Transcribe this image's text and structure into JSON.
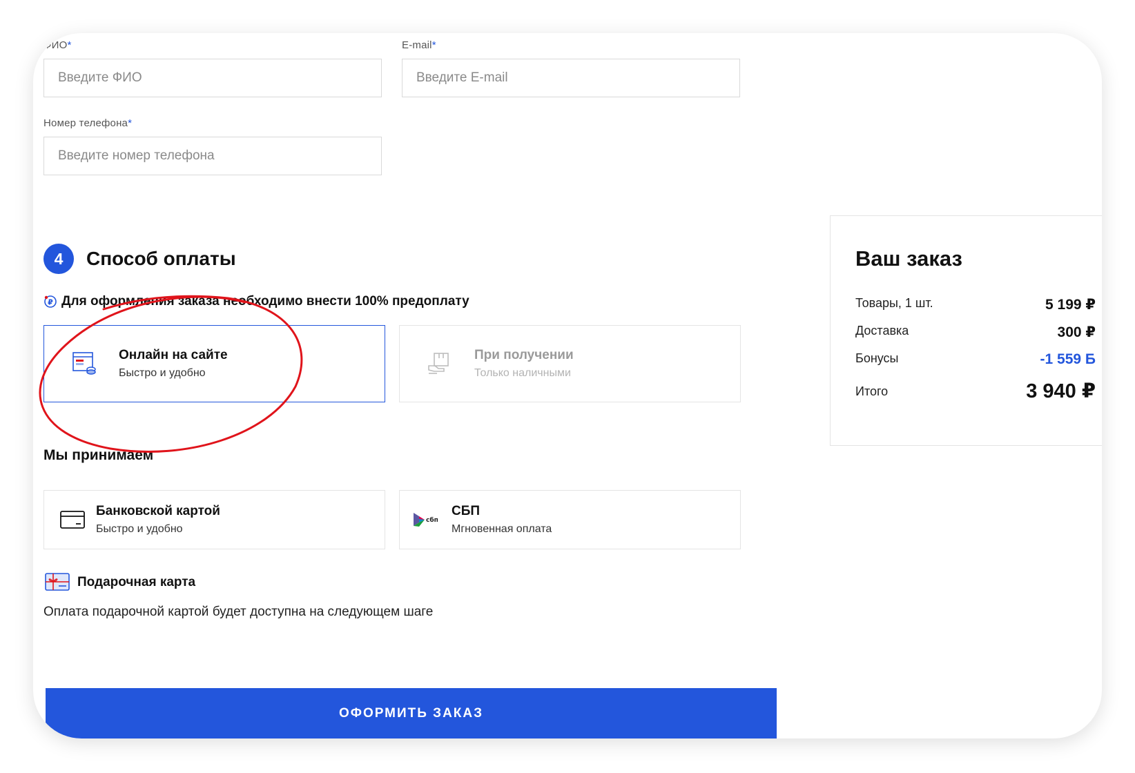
{
  "form": {
    "fio": {
      "label": "ФИО",
      "required_mark": "*",
      "placeholder": "Введите ФИО"
    },
    "email": {
      "label": "E-mail",
      "required_mark": "*",
      "placeholder": "Введите E-mail"
    },
    "phone": {
      "label": "Номер телефона",
      "required_mark": "*",
      "placeholder": "Введите номер телефона"
    }
  },
  "payment": {
    "step_number": "4",
    "title": "Способ оплаты",
    "note": "Для оформления заказа необходимо внести 100% предоплату",
    "options": [
      {
        "title": "Онлайн на сайте",
        "subtitle": "Быстро и удобно",
        "icon": "online-payment-icon",
        "selected": true
      },
      {
        "title": "При получении",
        "subtitle": "Только наличными",
        "icon": "cash-on-delivery-icon",
        "selected": false
      }
    ],
    "accept_title": "Мы принимаем",
    "methods": [
      {
        "title": "Банковской картой",
        "subtitle": "Быстро и удобно",
        "icon": "bank-card-icon"
      },
      {
        "title": "СБП",
        "subtitle": "Мгновенная оплата",
        "icon": "sbp-logo-icon",
        "logo_text": "сбп"
      }
    ],
    "gift_card": {
      "title": "Подарочная карта",
      "text": "Оплата подарочной картой будет доступна на следующем шаге"
    },
    "submit_label": "ОФОРМИТЬ ЗАКАЗ"
  },
  "summary": {
    "title": "Ваш заказ",
    "rows": [
      {
        "label": "Товары, 1 шт.",
        "value": "5 199 ₽"
      },
      {
        "label": "Доставка",
        "value": "300 ₽"
      },
      {
        "label": "Бонусы",
        "value": "-1 559 Б"
      }
    ],
    "total": {
      "label": "Итого",
      "value": "3 940 ₽"
    }
  },
  "colors": {
    "accent": "#2356dc",
    "annotation": "#e0141b"
  }
}
